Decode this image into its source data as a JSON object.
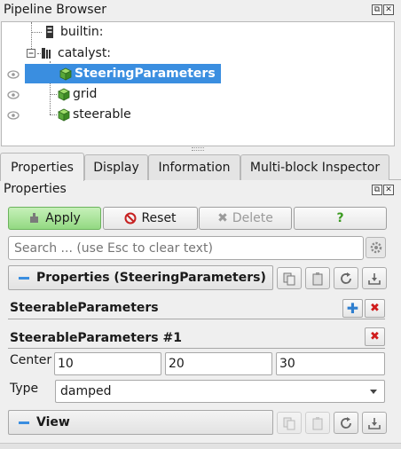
{
  "pipeline_panel": {
    "title": "Pipeline Browser",
    "items": [
      {
        "label": "builtin:",
        "icon": "server-icon"
      },
      {
        "label": "catalyst:",
        "icon": "server-icon"
      },
      {
        "label": "SteeringParameters",
        "icon": "cube-icon",
        "selected": true
      },
      {
        "label": "grid",
        "icon": "cube-icon"
      },
      {
        "label": "steerable",
        "icon": "cube-icon"
      }
    ]
  },
  "tabs": [
    "Properties",
    "Display",
    "Information",
    "Multi-block Inspector"
  ],
  "properties_panel": {
    "title": "Properties",
    "buttons": {
      "apply": "Apply",
      "reset": "Reset",
      "delete": "Delete",
      "help": "?"
    },
    "search_placeholder": "Search ... (use Esc to clear text)",
    "section_title": "Properties (SteeringParameters)",
    "group_title": "SteerableParameters",
    "subgroup_title": "SteerableParameters #1",
    "center_label": "Center",
    "center_values": [
      "10",
      "20",
      "30"
    ],
    "type_label": "Type",
    "type_value": "damped",
    "view_section_title": "View"
  },
  "colors": {
    "selection": "#3a8ee0",
    "apply_green": "#93d982",
    "delete_red": "#d01c1c",
    "add_blue": "#2f7fcf"
  }
}
